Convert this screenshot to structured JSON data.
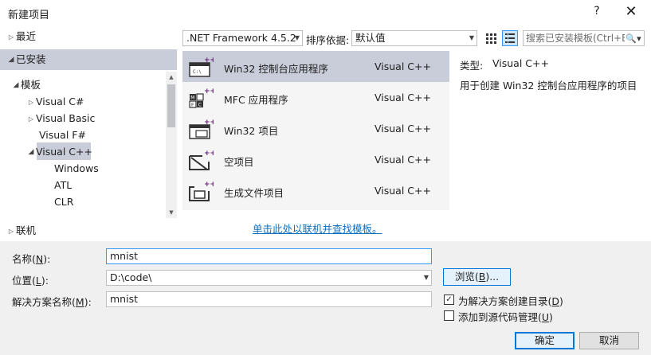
{
  "window": {
    "title": "新建项目",
    "help_glyph": "?",
    "close_glyph": "✕"
  },
  "left_tree": {
    "recent": "最近",
    "installed": "已安装",
    "templates": "模板",
    "visual_csharp": "Visual C#",
    "visual_basic": "Visual Basic",
    "visual_fsharp": "Visual F#",
    "visual_cpp": "Visual C++",
    "windows": "Windows",
    "atl": "ATL",
    "clr": "CLR",
    "online": "联机"
  },
  "toolbar": {
    "framework": ".NET Framework 4.5.2",
    "sort_label": "排序依据:",
    "sort_value": "默认值",
    "search_placeholder": "搜索已安装模板(Ctrl+E)"
  },
  "templates": [
    {
      "name": "Win32 控制台应用程序",
      "language": "Visual C++",
      "icon": "console-app-icon",
      "selected": true
    },
    {
      "name": "MFC 应用程序",
      "language": "Visual C++",
      "icon": "mfc-app-icon",
      "selected": false
    },
    {
      "name": "Win32 项目",
      "language": "Visual C++",
      "icon": "win32-project-icon",
      "selected": false
    },
    {
      "name": "空项目",
      "language": "Visual C++",
      "icon": "empty-project-icon",
      "selected": false
    },
    {
      "name": "生成文件项目",
      "language": "Visual C++",
      "icon": "makefile-project-icon",
      "selected": false
    }
  ],
  "description": {
    "type_label": "类型:",
    "type_value": "Visual C++",
    "text": "用于创建 Win32 控制台应用程序的项目"
  },
  "online_link": "单击此处以联机并查找模板。",
  "form": {
    "name_label_pre": "名称(",
    "name_label_key": "N",
    "name_label_post": "):",
    "name_value": "mnist",
    "location_label_pre": "位置(",
    "location_label_key": "L",
    "location_label_post": "):",
    "location_value": "D:\\code\\",
    "solution_label_pre": "解决方案名称(",
    "solution_label_key": "M",
    "solution_label_post": "):",
    "solution_value": "mnist",
    "browse_pre": "浏览(",
    "browse_key": "B",
    "browse_post": ")...",
    "create_dir_pre": "为解决方案创建目录(",
    "create_dir_key": "D",
    "create_dir_post": ")",
    "create_dir_checked": true,
    "source_ctl_pre": "添加到源代码管理(",
    "source_ctl_key": "U",
    "source_ctl_post": ")",
    "source_ctl_checked": false,
    "ok": "确定",
    "cancel": "取消"
  },
  "colors": {
    "selection": "#c9ccd9",
    "accent": "#0078d7",
    "link": "#0e70c0",
    "icon_accent": "#68217a"
  }
}
